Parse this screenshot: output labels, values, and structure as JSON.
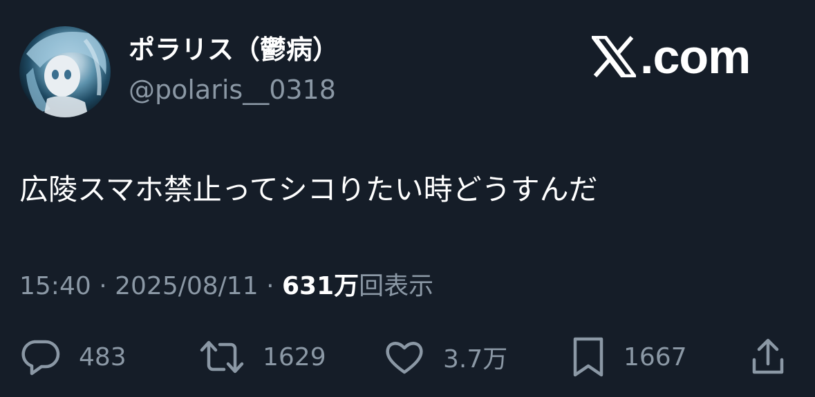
{
  "user": {
    "display_name": "ポラリス（鬱病）",
    "handle": "@polaris__0318"
  },
  "brand": {
    "text": ".com",
    "icon": "x-logo-icon"
  },
  "tweet": {
    "text": "広陵スマホ禁止ってシコりたい時どうすんだ"
  },
  "meta": {
    "time": "15:40",
    "separator": "·",
    "date": "2025/08/11",
    "views_count": "631万",
    "views_label": "回表示"
  },
  "actions": {
    "replies": {
      "icon": "reply-icon",
      "count": "483"
    },
    "retweets": {
      "icon": "retweet-icon",
      "count": "1629"
    },
    "likes": {
      "icon": "heart-icon",
      "count": "3.7万"
    },
    "bookmarks": {
      "icon": "bookmark-icon",
      "count": "1667"
    },
    "share": {
      "icon": "share-icon"
    }
  },
  "colors": {
    "background": "#151d28",
    "primary_text": "#ffffff",
    "secondary_text": "#8b98a5"
  }
}
